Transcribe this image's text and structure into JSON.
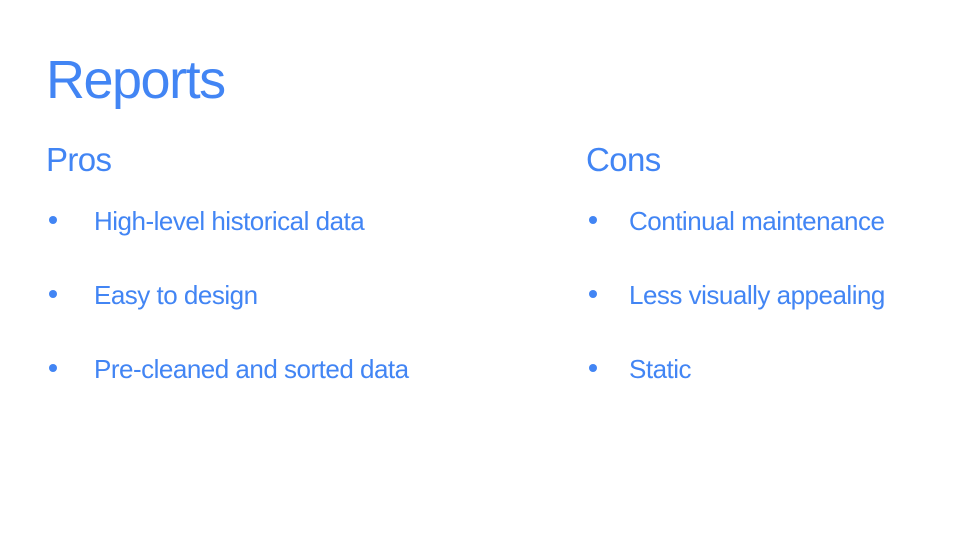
{
  "slide": {
    "title": "Reports",
    "accent_color": "#4285f4",
    "pros": {
      "heading": "Pros",
      "items": [
        "High-level historical data",
        "Easy to design",
        "Pre-cleaned and sorted data"
      ]
    },
    "cons": {
      "heading": "Cons",
      "items": [
        "Continual maintenance",
        "Less visually appealing",
        "Static"
      ]
    }
  }
}
